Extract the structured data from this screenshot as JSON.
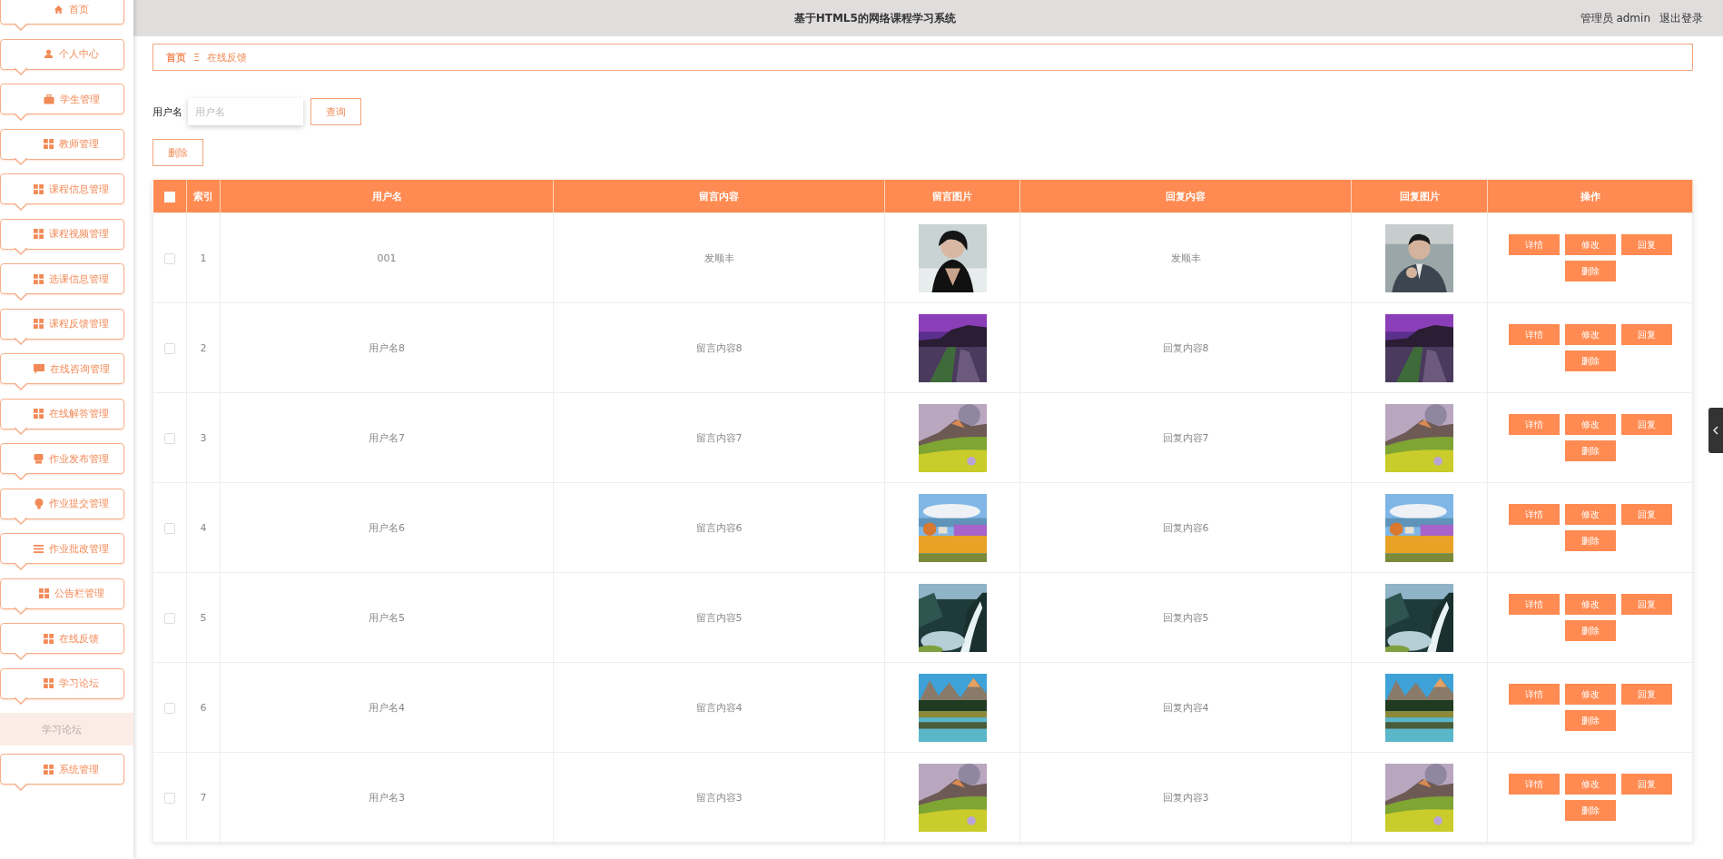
{
  "sidebar": {
    "items": [
      {
        "label": "首页",
        "kind": "home"
      },
      {
        "label": "个人中心",
        "kind": "user"
      },
      {
        "label": "学生管理",
        "kind": "briefcase"
      },
      {
        "label": "教师管理",
        "kind": "grid"
      },
      {
        "label": "课程信息管理",
        "kind": "grid"
      },
      {
        "label": "课程视频管理",
        "kind": "grid"
      },
      {
        "label": "选课信息管理",
        "kind": "grid"
      },
      {
        "label": "课程反馈管理",
        "kind": "grid"
      },
      {
        "label": "在线咨询管理",
        "kind": "chat"
      },
      {
        "label": "在线解答管理",
        "kind": "grid"
      },
      {
        "label": "作业发布管理",
        "kind": "monitor"
      },
      {
        "label": "作业提交管理",
        "kind": "bulb"
      },
      {
        "label": "作业批改管理",
        "kind": "list"
      },
      {
        "label": "公告栏管理",
        "kind": "grid"
      },
      {
        "label": "在线反馈",
        "kind": "grid"
      },
      {
        "label": "学习论坛",
        "kind": "grid",
        "children": [
          {
            "label": "学习论坛",
            "selected": true
          }
        ]
      },
      {
        "label": "系统管理",
        "kind": "grid"
      }
    ]
  },
  "header": {
    "title": "基于HTML5的网络课程学习系统",
    "user": "管理员 admin",
    "logout": "退出登录"
  },
  "breadcrumb": {
    "home": "首页",
    "separator": "Ξ",
    "current": "在线反馈"
  },
  "search": {
    "label": "用户名",
    "placeholder": "用户名",
    "button": "查询"
  },
  "delete_button": "删除",
  "table": {
    "select_all": {
      "checked": false
    },
    "columns": [
      "索引",
      "用户名",
      "留言内容",
      "留言图片",
      "回复内容",
      "回复图片",
      "操作"
    ],
    "rows": [
      {
        "checked": false,
        "index": "1",
        "username": "001",
        "message": "发顺丰",
        "reply": "发顺丰",
        "actions": [
          "详情",
          "修改",
          "回复",
          "删除"
        ]
      },
      {
        "checked": false,
        "index": "2",
        "username": "用户名8",
        "message": "留言内容8",
        "reply": "回复内容8",
        "actions": [
          "详情",
          "修改",
          "回复",
          "删除"
        ]
      },
      {
        "checked": false,
        "index": "3",
        "username": "用户名7",
        "message": "留言内容7",
        "reply": "回复内容7",
        "actions": [
          "详情",
          "修改",
          "回复",
          "删除"
        ]
      },
      {
        "checked": false,
        "index": "4",
        "username": "用户名6",
        "message": "留言内容6",
        "reply": "回复内容6",
        "actions": [
          "详情",
          "修改",
          "回复",
          "删除"
        ]
      },
      {
        "checked": false,
        "index": "5",
        "username": "用户名5",
        "message": "留言内容5",
        "reply": "回复内容5",
        "actions": [
          "详情",
          "修改",
          "回复",
          "删除"
        ]
      },
      {
        "checked": false,
        "index": "6",
        "username": "用户名4",
        "message": "留言内容4",
        "reply": "回复内容4",
        "actions": [
          "详情",
          "修改",
          "回复",
          "删除"
        ]
      },
      {
        "checked": false,
        "index": "7",
        "username": "用户名3",
        "message": "留言内容3",
        "reply": "回复内容3",
        "actions": [
          "详情",
          "修改",
          "回复",
          "删除"
        ]
      }
    ]
  }
}
